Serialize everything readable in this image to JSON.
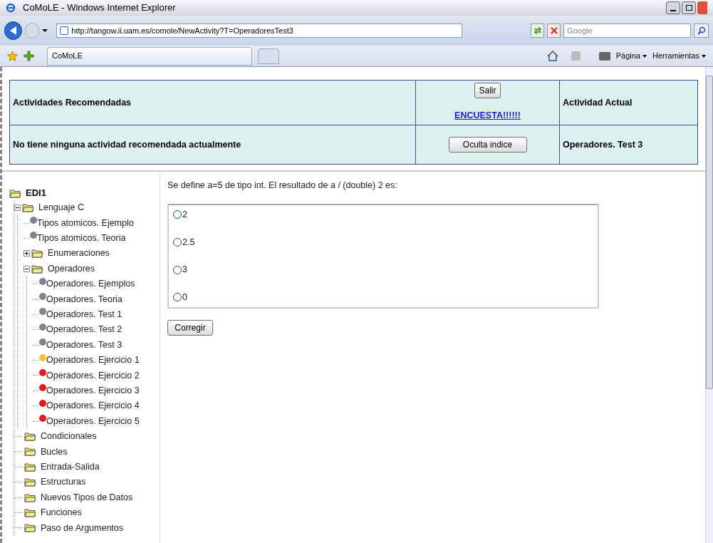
{
  "window": {
    "title": "CoMoLE - Windows Internet Explorer"
  },
  "address_bar": {
    "url": "http://tangow.ii.uam.es/comole/NewActivity?T=OperadoresTest3"
  },
  "search": {
    "placeholder": "Google"
  },
  "tabs": [
    {
      "label": "CoMoLE",
      "selected": true
    }
  ],
  "toolbar": [
    {
      "label": "Página"
    },
    {
      "label": "Herramientas"
    }
  ],
  "header_table": {
    "recommended_title": "Actividades Recomendadas",
    "recommended_text": "No tiene ninguna actividad recomendada actualmente",
    "exit_button": "Salir",
    "survey_link": "ENCUESTA!!!!!!",
    "hide_index_button": "Oculta indice",
    "current_title": "Actividad Actual",
    "current_activity": "Operadores. Test 3"
  },
  "tree": {
    "label": "EDI1",
    "children": [
      {
        "kind": "folder",
        "label": "Lenguaje C",
        "expanded": true,
        "children": [
          {
            "kind": "leaf",
            "label": "Tipos atomicos. Ejemplo",
            "color": "#7c8590"
          },
          {
            "kind": "leaf",
            "label": "Tipos atomicos. Teoria",
            "color": "#7c8590"
          },
          {
            "kind": "folder",
            "label": "Enumeraciones",
            "expanded": false
          },
          {
            "kind": "folder",
            "label": "Operadores",
            "expanded": true,
            "children": [
              {
                "kind": "leaf",
                "label": "Operadores. Ejemplos",
                "color": "#7c8590"
              },
              {
                "kind": "leaf",
                "label": "Operadores. Teoria",
                "color": "#7c8590"
              },
              {
                "kind": "leaf",
                "label": "Operadores. Test 1",
                "color": "#7c8590"
              },
              {
                "kind": "leaf",
                "label": "Operadores. Test 2",
                "color": "#7c8590"
              },
              {
                "kind": "leaf",
                "label": "Operadores. Test 3",
                "color": "#7c8590"
              },
              {
                "kind": "leaf",
                "label": "Operadores. Ejercicio 1",
                "color": "#f2c53a"
              },
              {
                "kind": "leaf",
                "label": "Operadores. Ejercicio 2",
                "color": "#e41b1b"
              },
              {
                "kind": "leaf",
                "label": "Operadores. Ejercicio 3",
                "color": "#e41b1b"
              },
              {
                "kind": "leaf",
                "label": "Operadores. Ejercicio 4",
                "color": "#e41b1b"
              },
              {
                "kind": "leaf",
                "label": "Operadores. Ejercicio 5",
                "color": "#e41b1b"
              }
            ]
          }
        ]
      },
      {
        "kind": "group",
        "label": "Condicionales"
      },
      {
        "kind": "group",
        "label": "Bucles"
      },
      {
        "kind": "group",
        "label": "Entrada-Salida"
      },
      {
        "kind": "group",
        "label": "Estructuras"
      },
      {
        "kind": "group",
        "label": "Nuevos Tipos de Datos"
      },
      {
        "kind": "group",
        "label": "Funciones"
      },
      {
        "kind": "group",
        "label": "Paso de Argumentos"
      }
    ]
  },
  "question": {
    "text": "Se define a=5 de tipo int. El resultado de a / (double) 2 es:",
    "options": [
      {
        "label": "2",
        "selected": false
      },
      {
        "label": "2.5",
        "selected": false
      },
      {
        "label": "3",
        "selected": false
      },
      {
        "label": "0",
        "selected": false
      }
    ],
    "submit_button": "Corregir"
  }
}
